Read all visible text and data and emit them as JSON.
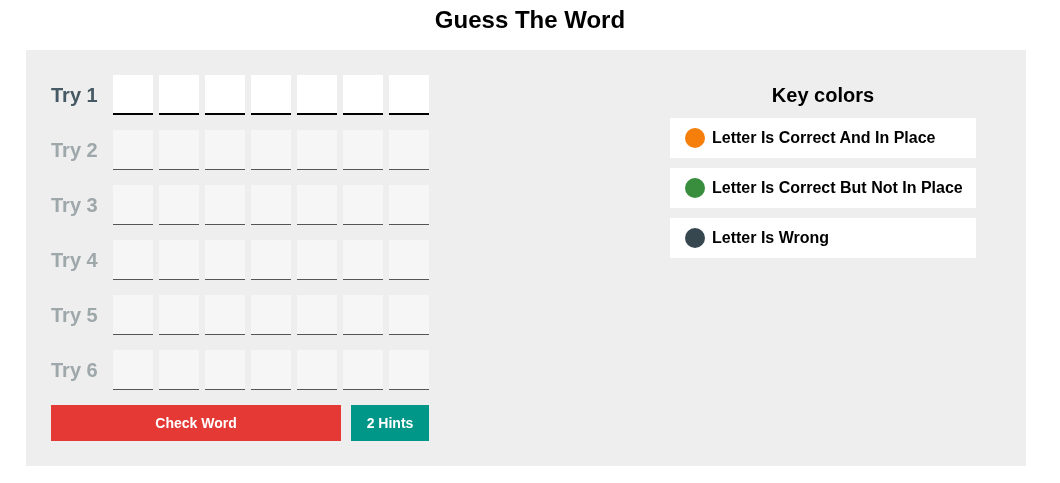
{
  "title": "Guess The Word",
  "tries": [
    {
      "label": "Try 1",
      "disabled": false
    },
    {
      "label": "Try 2",
      "disabled": true
    },
    {
      "label": "Try 3",
      "disabled": true
    },
    {
      "label": "Try 4",
      "disabled": true
    },
    {
      "label": "Try 5",
      "disabled": true
    },
    {
      "label": "Try 6",
      "disabled": true
    }
  ],
  "buttons": {
    "check": "Check Word",
    "hints": "2 Hints"
  },
  "key": {
    "title": "Key colors",
    "items": [
      {
        "label": "Letter Is Correct And In Place",
        "color": "#f57f0a"
      },
      {
        "label": "Letter Is Correct But Not In Place",
        "color": "#388e3c"
      },
      {
        "label": "Letter Is Wrong",
        "color": "#37474f"
      }
    ]
  }
}
